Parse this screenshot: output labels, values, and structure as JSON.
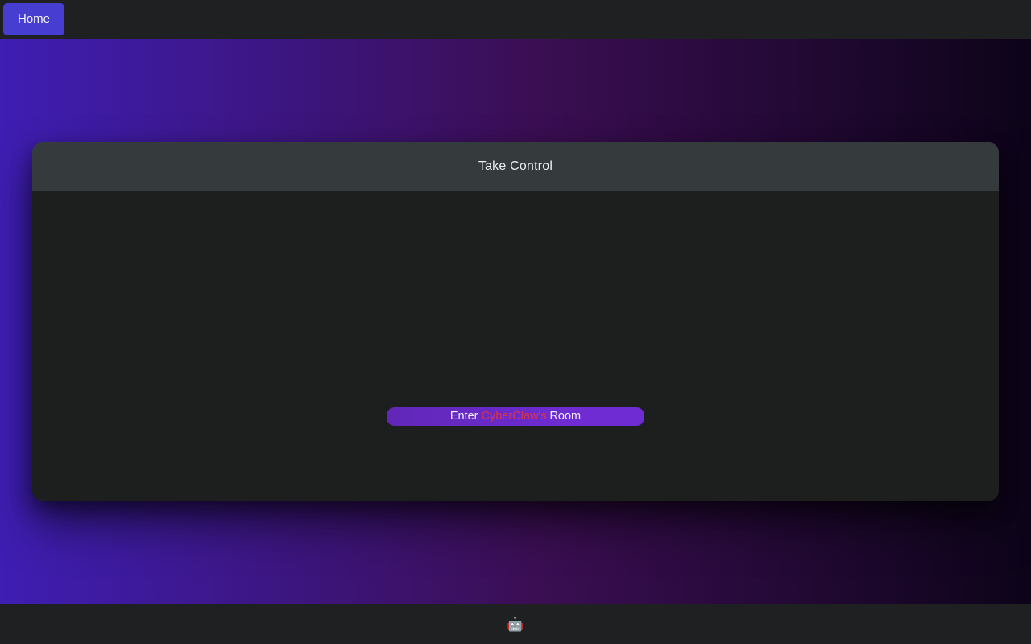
{
  "navbar": {
    "home_button_label": "Home"
  },
  "main": {
    "card": {
      "title": "Take Control",
      "enter_button": {
        "text_prefix": "Enter",
        "text_highlight": "CyberClaw's",
        "text_suffix": "Room"
      }
    }
  },
  "footer": {
    "robot_icon": "🤖"
  },
  "colors": {
    "navbar_bg": "#1e2021",
    "accent_indigo": "#473dd0",
    "gradient_left": "#3e1eb3",
    "gradient_mid": "#3b0e53",
    "gradient_right": "#0d0419",
    "card_header_bg": "#353a3d",
    "card_body_bg": "#1d1f1e",
    "button_purple_start": "#6127b8",
    "button_purple_end": "#6e2cd2",
    "highlight_red": "#dc3545"
  }
}
